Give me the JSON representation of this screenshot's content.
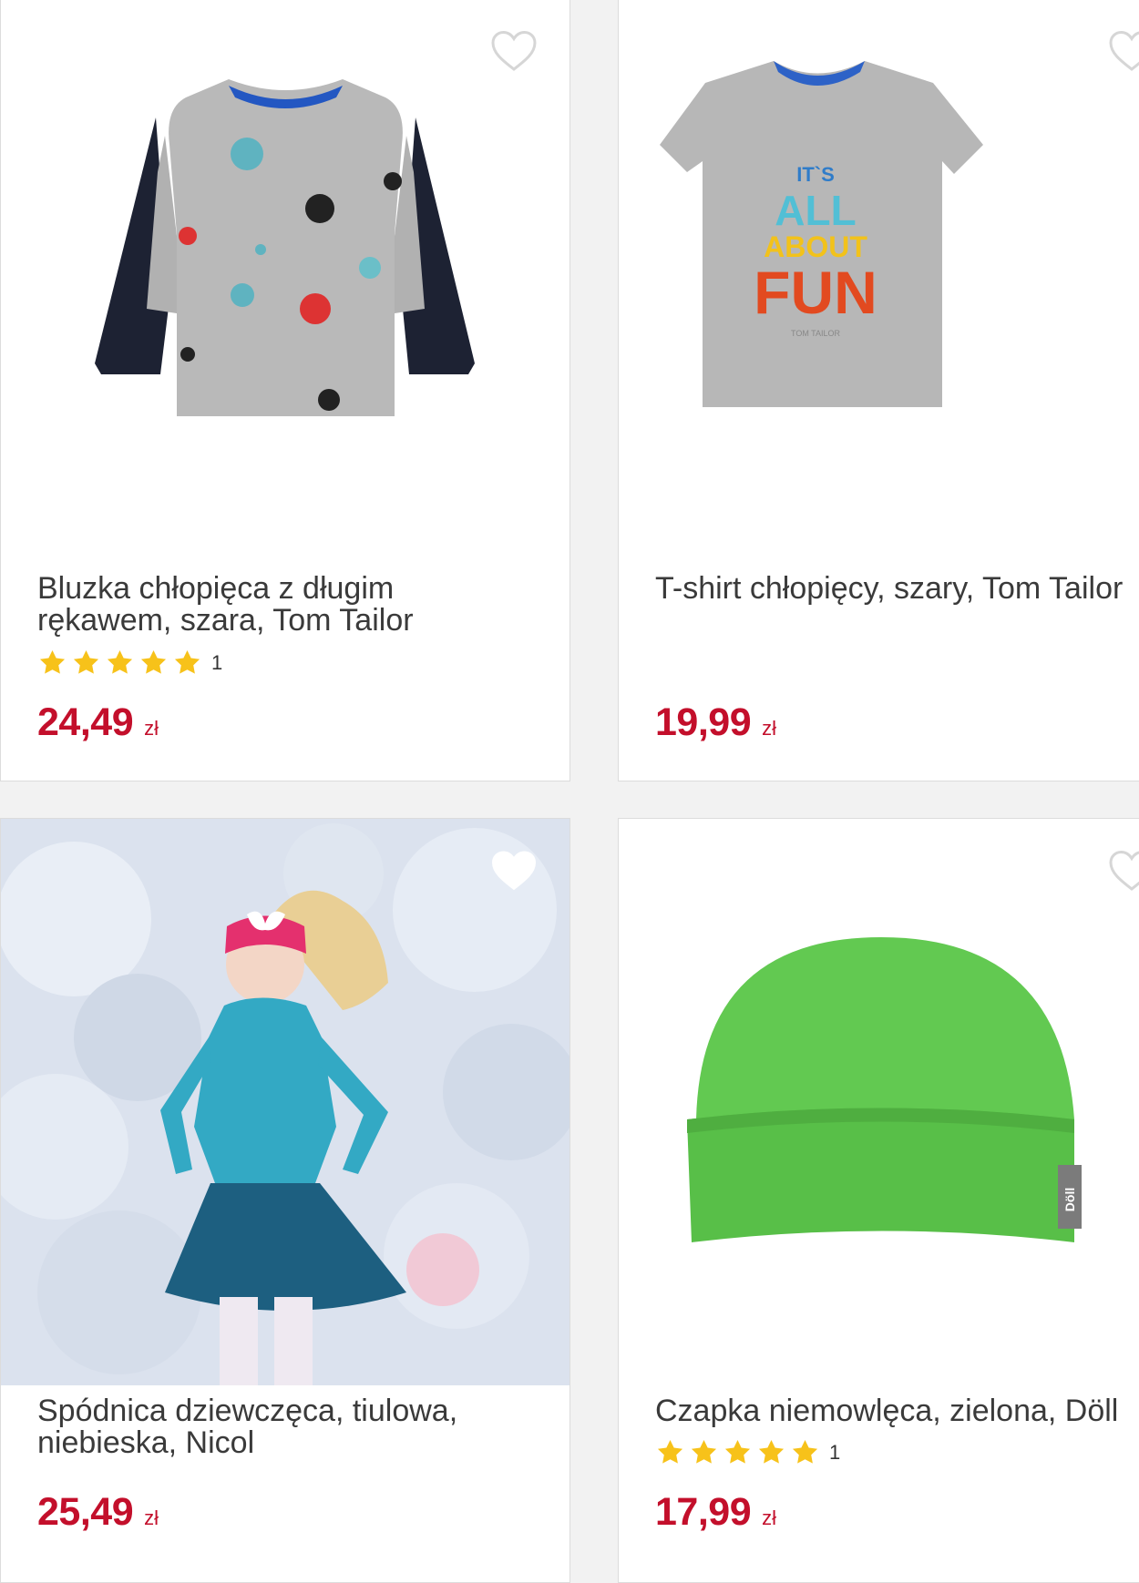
{
  "colors": {
    "price": "#c30f2b",
    "star": "#f7c21a",
    "heart_outline": "#d6d6d6"
  },
  "products": [
    {
      "title": "Bluzka chłopięca z długim rękawem, szara, Tom Tailor",
      "rating_count": "1",
      "rating_stars": 5,
      "price": "24,49",
      "currency": "zł"
    },
    {
      "title": "T-shirt chłopięcy, szary, Tom Tailor",
      "price": "19,99",
      "currency": "zł",
      "print_text": [
        "IT`S",
        "ALL",
        "ABOUT",
        "FUN",
        "TOM TAILOR"
      ]
    },
    {
      "title": "Spódnica dziewczęca, tiulowa, niebieska, Nicol",
      "price": "25,49",
      "currency": "zł"
    },
    {
      "title": "Czapka niemowlęca, zielona, Döll",
      "rating_count": "1",
      "rating_stars": 5,
      "price": "17,99",
      "currency": "zł",
      "tag_text": "Döll"
    }
  ]
}
